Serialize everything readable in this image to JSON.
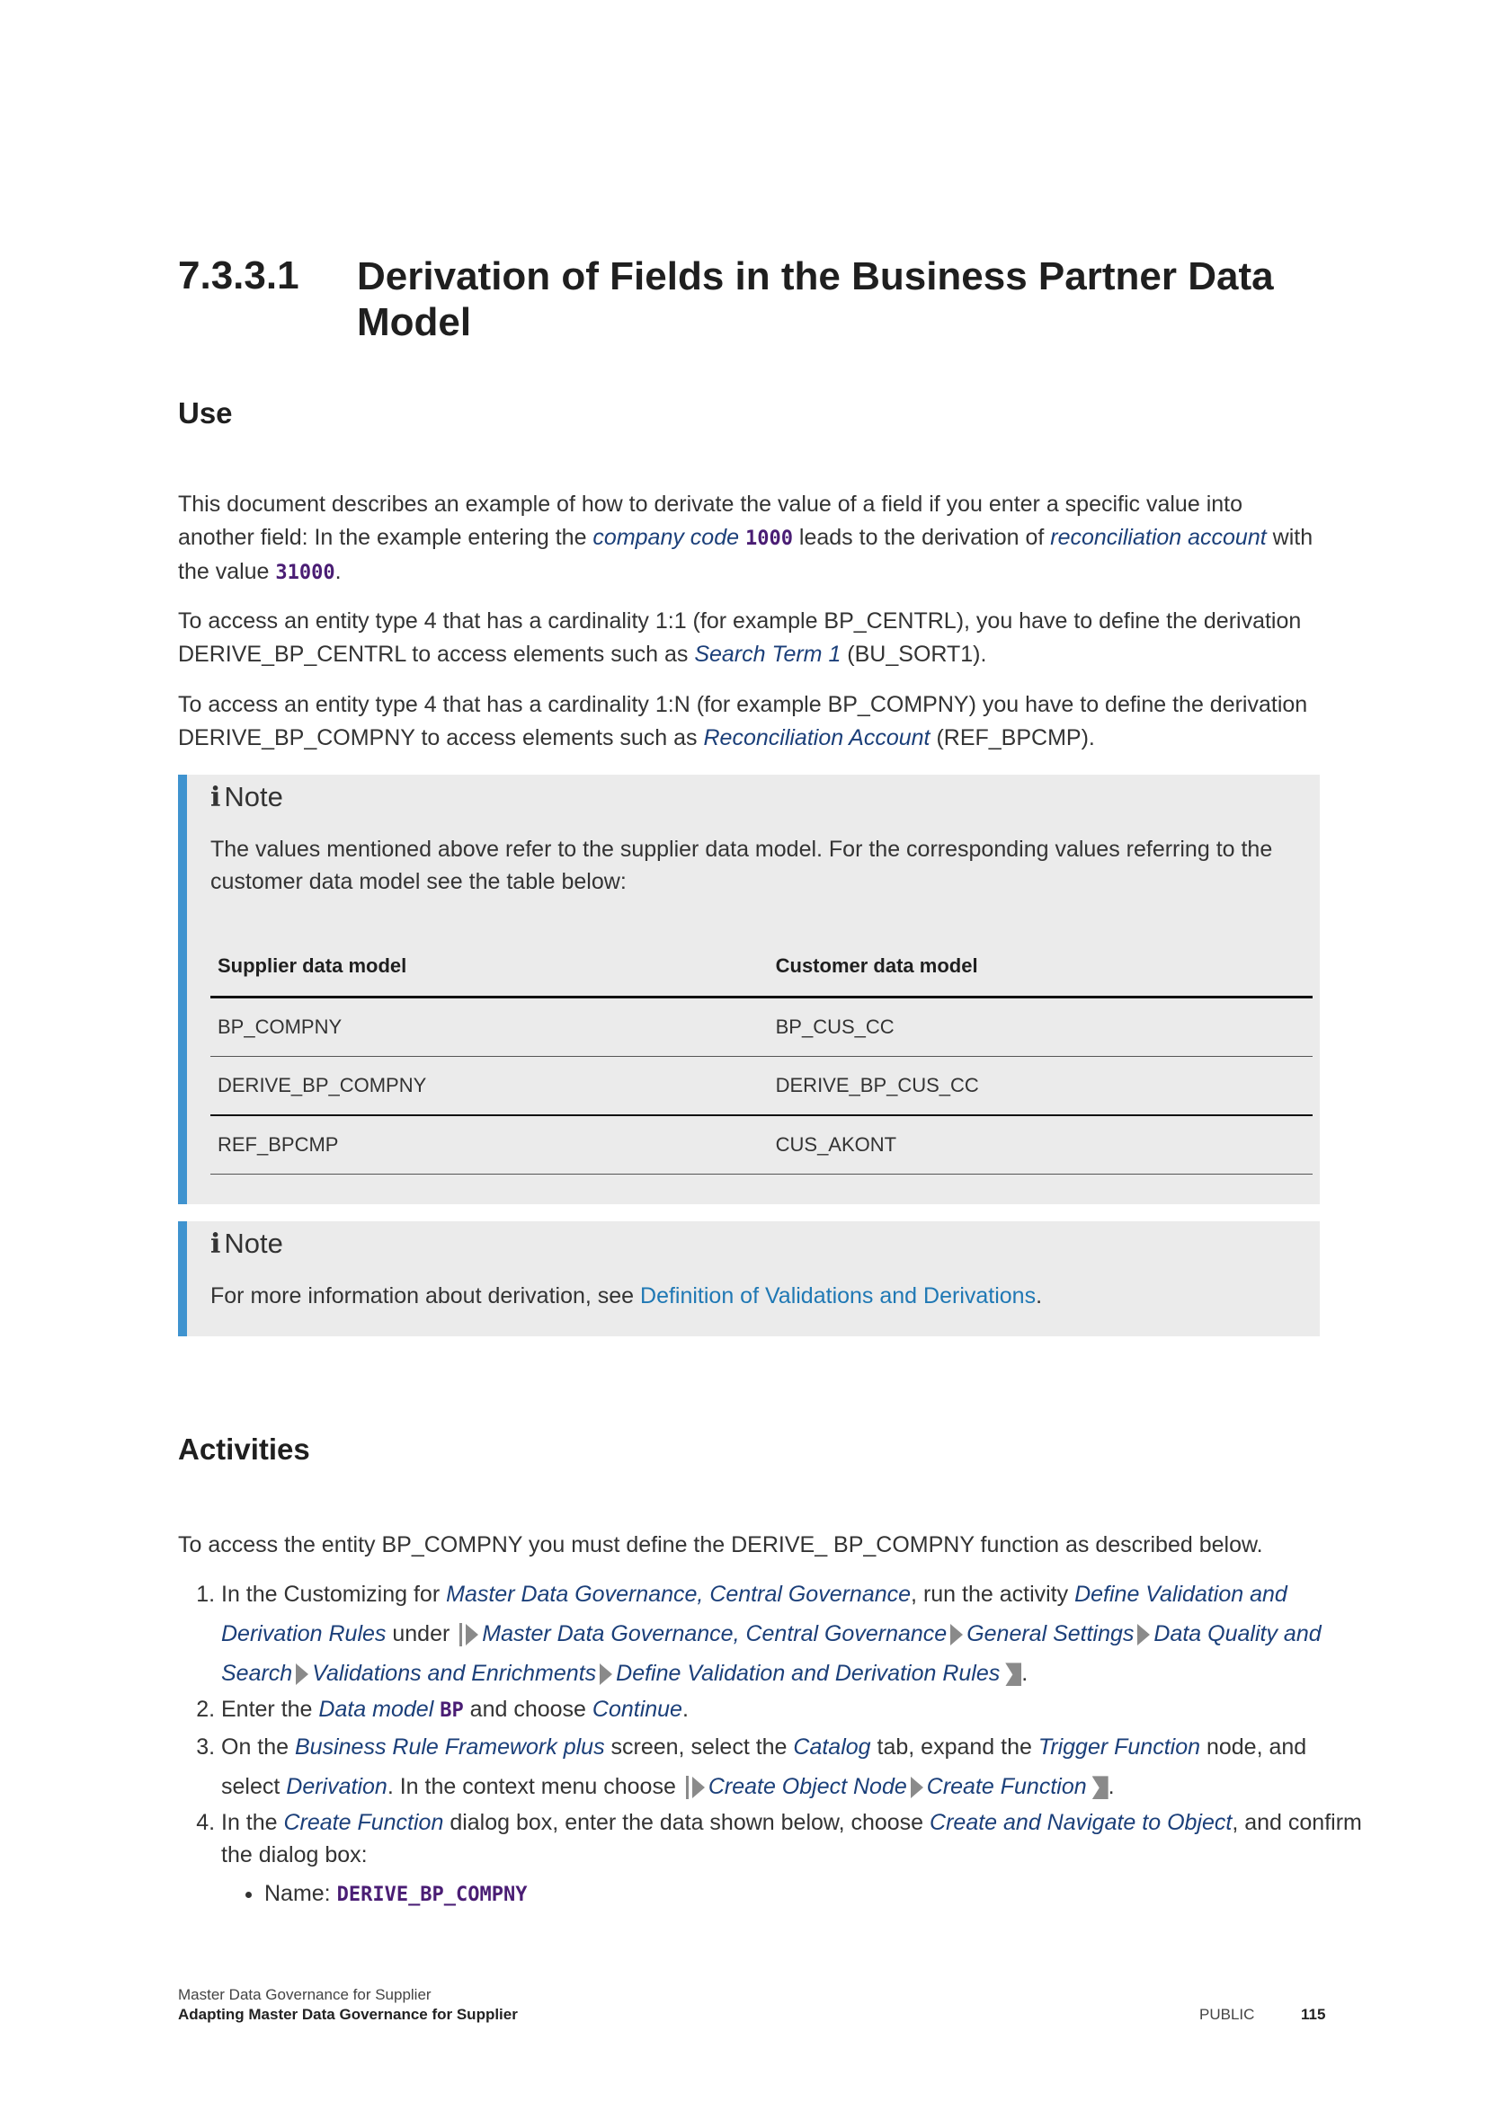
{
  "section": {
    "number": "7.3.3.1",
    "title": "Derivation of Fields in the Business Partner Data Model"
  },
  "use": {
    "heading": "Use",
    "p1": {
      "t1": "This document describes an example of how to derivate the value of a field if you enter a specific value into another field: In the example entering the ",
      "link1": "company code",
      "code1": "1000",
      "t2": " leads to the derivation of ",
      "link2": "reconciliation account",
      "t3": " with the value ",
      "code2": "31000",
      "t4": "."
    },
    "p2": {
      "t1": "To access an entity type 4 that has a cardinality 1:1 (for example BP_CENTRL), you have to define the derivation DERIVE_BP_CENTRL to access elements such as ",
      "link1": "Search Term 1",
      "t2": " (BU_SORT1)."
    },
    "p3": {
      "t1": "To access an entity type 4 that has a cardinality 1:N (for example BP_COMPNY) you have to define the derivation DERIVE_BP_COMPNY to access elements such as ",
      "link1": "Reconciliation Account",
      "t2": " (REF_BPCMP)."
    }
  },
  "note1": {
    "icon": "i",
    "label": "Note",
    "text": "The values mentioned above refer to the supplier data model. For the corresponding values referring to the customer data model see the table below:",
    "table": {
      "headers": [
        "Supplier data model",
        "Customer data model"
      ],
      "rows": [
        [
          "BP_COMPNY",
          "BP_CUS_CC"
        ],
        [
          "DERIVE_BP_COMPNY",
          "DERIVE_BP_CUS_CC"
        ],
        [
          "REF_BPCMP",
          "CUS_AKONT"
        ]
      ]
    }
  },
  "note2": {
    "icon": "i",
    "label": "Note",
    "t1": "For more information about derivation, see ",
    "link": "Definition of Validations and Derivations",
    "t2": "."
  },
  "activities": {
    "heading": "Activities",
    "intro": "To access the entity BP_COMPNY you must define the DERIVE_ BP_COMPNY function as described below.",
    "step1": {
      "t1": "In the Customizing for ",
      "l1": "Master Data Governance, Central Governance",
      "t2": ", run the activity ",
      "l2": "Define Validation and Derivation Rules",
      "t3": " under ",
      "path": [
        "Master Data Governance, Central Governance",
        "General Settings",
        "Data Quality and Search",
        "Validations and Enrichments",
        "Define Validation and Derivation Rules"
      ],
      "t4": "."
    },
    "step2": {
      "t1": "Enter the ",
      "l1": "Data model",
      "code": "BP",
      "t2": " and choose ",
      "l2": "Continue",
      "t3": "."
    },
    "step3": {
      "t1": "On the ",
      "l1": "Business Rule Framework plus",
      "t2": " screen, select the ",
      "l2": "Catalog",
      "t3": " tab, expand the ",
      "l3": "Trigger Function",
      "t4": " node, and select ",
      "l4": "Derivation",
      "t5": ". In the context menu choose ",
      "path": [
        "Create Object Node",
        "Create Function"
      ],
      "t6": "."
    },
    "step4": {
      "t1": "In the ",
      "l1": "Create Function",
      "t2": " dialog box, enter the data shown below, choose ",
      "l2": "Create and Navigate to Object",
      "t3": ", and confirm the dialog box:",
      "bullet_label": "Name: ",
      "bullet_code": "DERIVE_BP_COMPNY"
    }
  },
  "footer": {
    "doc_title": "Master Data Governance for Supplier",
    "chapter": "Adapting Master Data Governance for Supplier",
    "classification": "PUBLIC",
    "page_number": "115"
  }
}
